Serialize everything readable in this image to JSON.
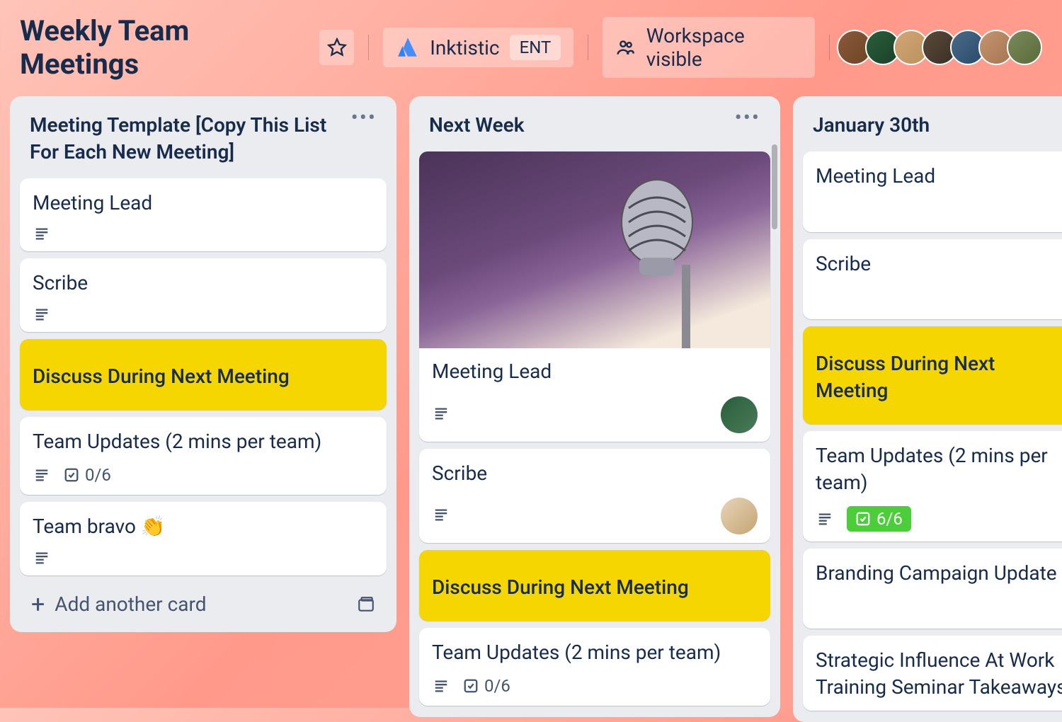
{
  "header": {
    "board_title": "Weekly Team Meetings",
    "workspace_name": "Inktistic",
    "workspace_badge": "ENT",
    "visibility_label": "Workspace visible"
  },
  "lists": [
    {
      "title": "Meeting Template [Copy This List For Each New Meeting]",
      "cards": [
        {
          "title": "Meeting Lead",
          "has_description": true
        },
        {
          "title": "Scribe",
          "has_description": true
        },
        {
          "title": "Discuss During Next Meeting",
          "yellow": true
        },
        {
          "title": "Team Updates (2 mins per team)",
          "has_description": true,
          "checklist": "0/6"
        },
        {
          "title": "Team bravo 👏",
          "has_description": true
        }
      ],
      "add_label": "Add another card"
    },
    {
      "title": "Next Week",
      "cards": [
        {
          "title": "Meeting Lead",
          "has_description": true,
          "has_cover": true,
          "avatar": "card-av-1"
        },
        {
          "title": "Scribe",
          "has_description": true,
          "avatar": "card-av-2"
        },
        {
          "title": "Discuss During Next Meeting",
          "yellow": true
        },
        {
          "title": "Team Updates (2 mins per team)",
          "has_description": true,
          "checklist": "0/6"
        }
      ]
    },
    {
      "title": "January 30th",
      "cards": [
        {
          "title": "Meeting Lead"
        },
        {
          "title": "Scribe"
        },
        {
          "title": "Discuss During Next Meeting",
          "yellow": true
        },
        {
          "title": "Team Updates (2 mins per team)",
          "has_description": true,
          "checklist": "6/6",
          "checklist_complete": true
        },
        {
          "title": "Branding Campaign Update"
        },
        {
          "title": "Strategic Influence At Work Training Seminar Takeaways"
        }
      ]
    }
  ]
}
